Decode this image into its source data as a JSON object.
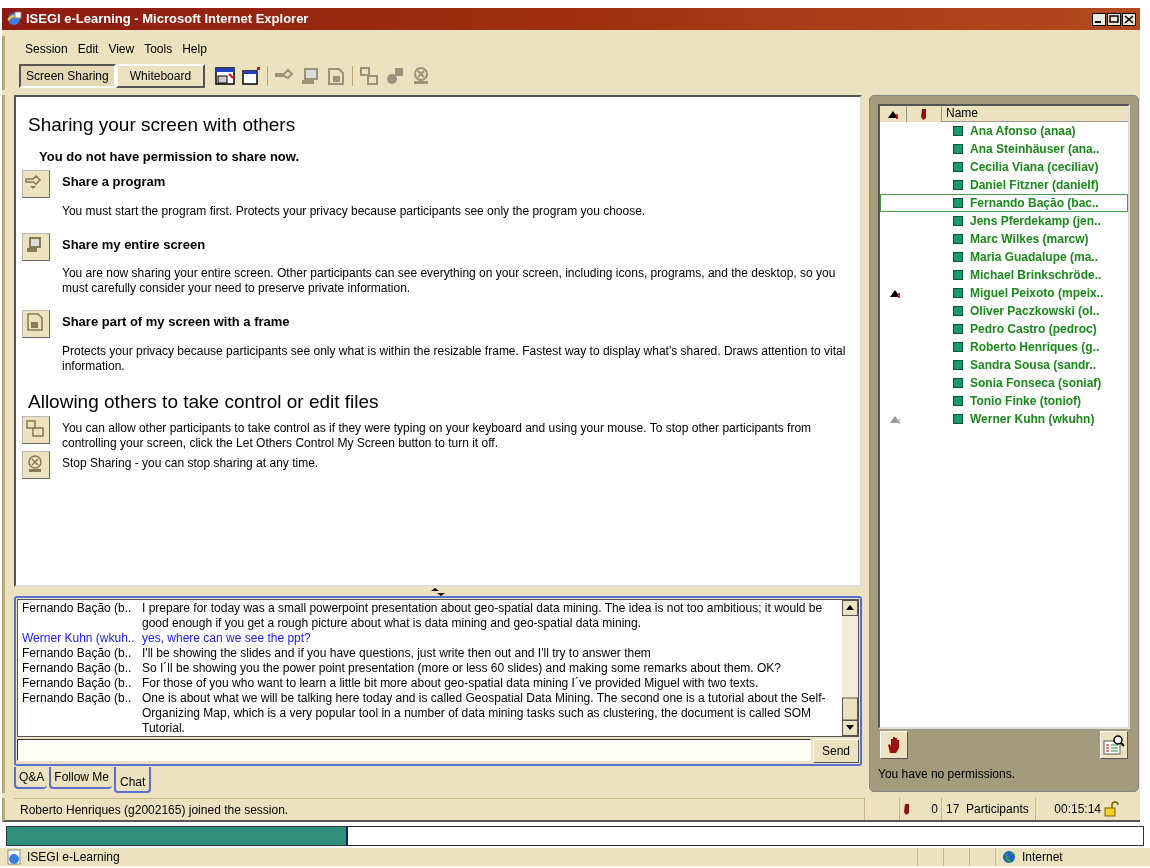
{
  "window": {
    "title": "ISEGI e-Learning - Microsoft Internet Explorer"
  },
  "menu": [
    "Session",
    "Edit",
    "View",
    "Tools",
    "Help"
  ],
  "mode_tabs": [
    {
      "label": "Screen Sharing",
      "selected": true
    },
    {
      "label": "Whiteboard",
      "selected": false
    }
  ],
  "sharing": {
    "heading": "Sharing your screen with others",
    "notice": "You do not have permission to share now.",
    "options": [
      {
        "kind": "program",
        "title": "Share a program",
        "description": "You must start the program first. Protects your privacy because participants see only the program you choose."
      },
      {
        "kind": "screen",
        "title": "Share my entire screen",
        "description": "You are now sharing your entire screen. Other participants can see everything on your screen, including icons, programs, and the desktop, so you must carefully consider your need to preserve private information."
      },
      {
        "kind": "frame",
        "title": "Share part of my screen with a frame",
        "description": "Protects your privacy because participants see only what is within the resizable frame. Fastest way to display what's shared. Draws attention to vital information."
      }
    ]
  },
  "control": {
    "heading": "Allowing others to take control or edit files",
    "options": [
      {
        "kind": "control",
        "description": "You can allow other participants to take control as if they were typing on your keyboard and using your mouse. To stop other participants from controlling your screen, click the Let Others Control My Screen button to turn it off."
      },
      {
        "kind": "stop",
        "description": "Stop Sharing - you can stop sharing at any time."
      }
    ]
  },
  "chat": {
    "messages": [
      {
        "sender": "Fernando Bação (b..",
        "text": "I prepare for today was a small powerpoint presentation about geo-spatial data mining. The idea is not too ambitious; it would be good enough if you get a rough picture about what is data mining and geo-spatial data mining.",
        "highlighted": false
      },
      {
        "sender": "Werner Kuhn (wkuh..",
        "text": "yes, where can we see the ppt?",
        "highlighted": true
      },
      {
        "sender": "Fernando Bação (b..",
        "text": "I'll be showing the slides and if you have questions, just write then out and I'll try to answer them",
        "highlighted": false
      },
      {
        "sender": "Fernando Bação (b..",
        "text": "So I´ll be showing you the power point presentation (more or less 60 slides) and making some remarks about them. OK?",
        "highlighted": false
      },
      {
        "sender": "Fernando Bação (b..",
        "text": "For those of you who want to learn a little bit more about geo-spatial data mining I´ve provided Miguel with two texts.",
        "highlighted": false
      },
      {
        "sender": "Fernando Bação (b..",
        "text": "One is about what we will be talking here today and is called Geospatial Data Mining. The second one is a tutorial about the Self-Organizing Map, which is a very popular tool in a number of data mining tasks such as clustering, the document is called SOM Tutorial.",
        "highlighted": false
      }
    ],
    "send_button": "Send",
    "tabs": [
      {
        "label": "Q&A",
        "selected": false
      },
      {
        "label": "Follow Me",
        "selected": false
      },
      {
        "label": "Chat",
        "selected": true
      }
    ]
  },
  "participants": {
    "column_3": "Name",
    "rows": [
      {
        "name": "Ana Afonso (anaa)",
        "selected": false,
        "presenter": false
      },
      {
        "name": "Ana Steinhäuser (ana..",
        "selected": false,
        "presenter": false
      },
      {
        "name": "Cecilia Viana (ceciliav)",
        "selected": false,
        "presenter": false
      },
      {
        "name": "Daniel Fitzner (danielf)",
        "selected": false,
        "presenter": false
      },
      {
        "name": "Fernando Bação (bac..",
        "selected": true,
        "presenter": false
      },
      {
        "name": "Jens Pferdekamp (jen..",
        "selected": false,
        "presenter": false
      },
      {
        "name": "Marc Wilkes (marcw)",
        "selected": false,
        "presenter": false
      },
      {
        "name": "Maria Guadalupe (ma..",
        "selected": false,
        "presenter": false
      },
      {
        "name": "Michael Brinkschröde..",
        "selected": false,
        "presenter": false
      },
      {
        "name": "Miguel Peixoto (mpeix..",
        "selected": false,
        "presenter": true,
        "presenter_dimmed": false
      },
      {
        "name": "Oliver Paczkowski (ol..",
        "selected": false,
        "presenter": false
      },
      {
        "name": "Pedro Castro (pedroc)",
        "selected": false,
        "presenter": false
      },
      {
        "name": "Roberto Henriques (g..",
        "selected": false,
        "presenter": false
      },
      {
        "name": "Sandra Sousa (sandr..",
        "selected": false,
        "presenter": false
      },
      {
        "name": "Sonia Fonseca (soniaf)",
        "selected": false,
        "presenter": false
      },
      {
        "name": "Tonio Finke (toniof)",
        "selected": false,
        "presenter": false
      },
      {
        "name": "Werner Kuhn (wkuhn)",
        "selected": false,
        "presenter": true,
        "presenter_dimmed": true
      }
    ],
    "permissions": "You have no permissions."
  },
  "status_bar": {
    "message": "Roberto Henriques (g2002165) joined the session.",
    "hands": "0",
    "participants": "17  Participants",
    "time": "00:15:14"
  },
  "browser_status": {
    "level": 0.3,
    "page": "ISEGI e-Learning",
    "zone": "Internet"
  }
}
